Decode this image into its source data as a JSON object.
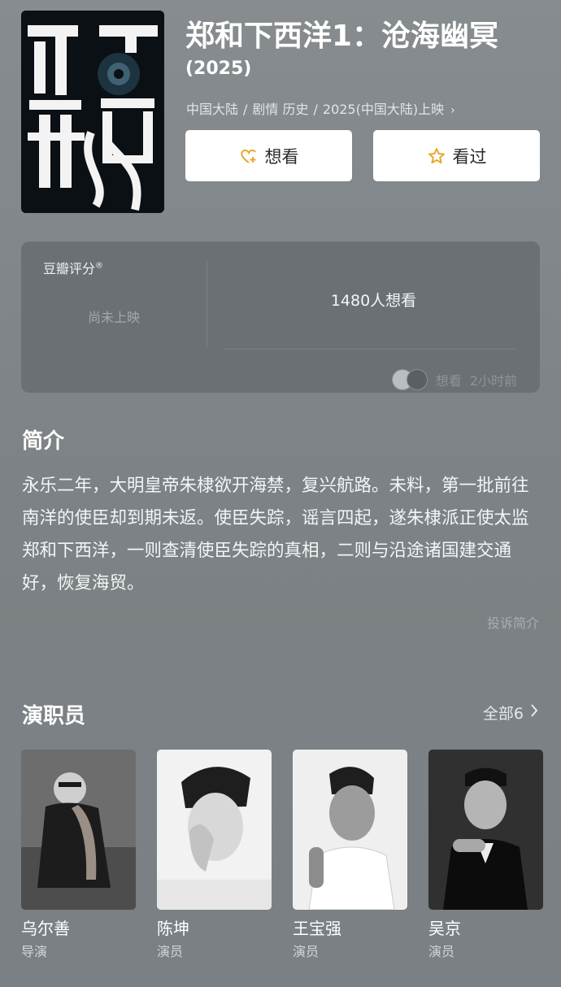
{
  "movie": {
    "title": "郑和下西洋1：沧海幽冥",
    "year": "(2025)",
    "meta": {
      "region": "中国大陆",
      "genres": "剧情 历史",
      "release": "2025(中国大陆)上映",
      "separator": "/"
    },
    "poster_text": "郑和下西洋"
  },
  "actions": {
    "want_label": "想看",
    "seen_label": "看过"
  },
  "rating": {
    "title": "豆瓣评分",
    "status": "尚未上映",
    "want_count": "1480人想看",
    "footer_label": "想看",
    "footer_time": "2小时前"
  },
  "intro": {
    "heading": "简介",
    "text": "永乐二年，大明皇帝朱棣欲开海禁，复兴航路。未料，第一批前往南洋的使臣却到期未返。使臣失踪，谣言四起，遂朱棣派正使太监郑和下西洋，一则查清使臣失踪的真相，二则与沿途诸国建交通好，恢复海贸。",
    "report_link": "投诉简介"
  },
  "cast": {
    "heading": "演职员",
    "all_label": "全部6",
    "members": [
      {
        "name": "乌尔善",
        "role": "导演"
      },
      {
        "name": "陈坤",
        "role": "演员"
      },
      {
        "name": "王宝强",
        "role": "演员"
      },
      {
        "name": "吴京",
        "role": "演员"
      }
    ]
  },
  "colors": {
    "background": "#7e8487",
    "card": "#6a7073",
    "button_bg": "#ffffff",
    "icon_accent": "#e8a92b"
  },
  "icons": [
    "heart-plus-icon",
    "star-icon",
    "chevron-right-icon"
  ]
}
